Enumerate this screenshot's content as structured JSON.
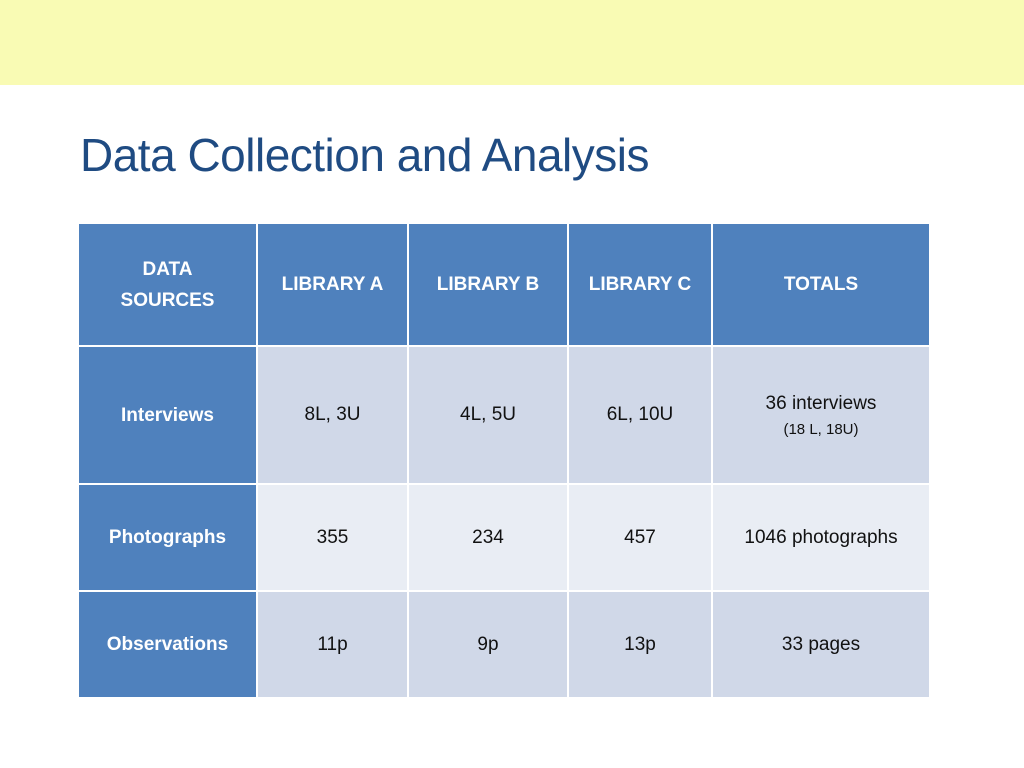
{
  "slide": {
    "title": "Data Collection and Analysis",
    "band_color": "#f9fbb4",
    "header_color": "#4f81bd"
  },
  "table": {
    "headers": [
      "DATA SOURCES",
      "LIBRARY A",
      "LIBRARY B",
      "LIBRARY C",
      "TOTALS"
    ],
    "rows": [
      {
        "label": "Interviews",
        "cells": [
          "8L, 3U",
          "4L, 5U",
          "6L, 10U"
        ],
        "total": "36 interviews",
        "total_sub": "(18 L, 18U)"
      },
      {
        "label": "Photographs",
        "cells": [
          "355",
          "234",
          "457"
        ],
        "total": "1046 photographs",
        "total_sub": ""
      },
      {
        "label": "Observations",
        "cells": [
          "11p",
          "9p",
          "13p"
        ],
        "total": "33 pages",
        "total_sub": ""
      }
    ]
  }
}
